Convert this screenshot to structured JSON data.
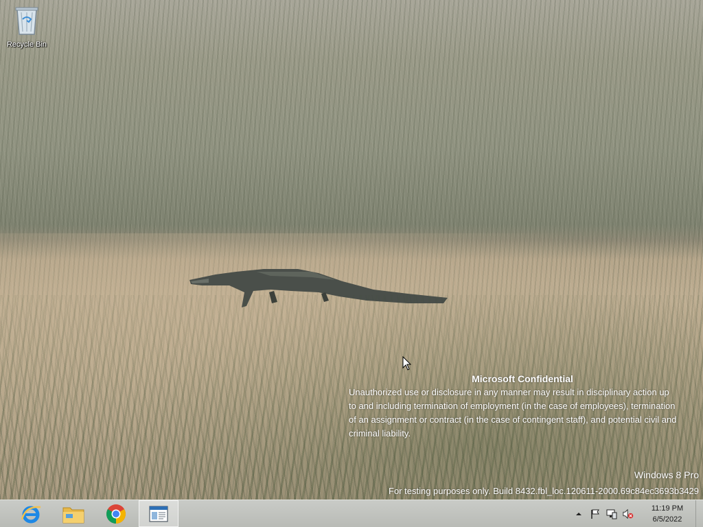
{
  "desktop": {
    "wallpaper": "alligator-in-marsh-grass",
    "icons": [
      {
        "label": "Recycle Bin",
        "icon": "recycle-bin-icon"
      }
    ]
  },
  "watermark": {
    "title": "Microsoft Confidential",
    "body": "Unauthorized use or disclosure in any manner may result in disciplinary action up to and including termination of employment (in the case of employees), termination of an assignment or contract (in the case of contingent staff), and potential civil and criminal liability.",
    "edition": "Windows 8 Pro",
    "build": "For testing purposes only. Build 8432.fbl_loc.120611-2000.69c84ec3693b3429"
  },
  "taskbar": {
    "pinned": [
      {
        "name": "internet-explorer",
        "icon": "internet-explorer-icon",
        "active": false
      },
      {
        "name": "file-explorer",
        "icon": "folder-icon",
        "active": false
      },
      {
        "name": "google-chrome",
        "icon": "chrome-icon",
        "active": false
      },
      {
        "name": "open-window",
        "icon": "window-icon",
        "active": true
      }
    ],
    "tray": {
      "icons": [
        "show-hidden-icons-arrow",
        "action-center-flag-icon",
        "network-icon",
        "volume-muted-icon"
      ],
      "time": "11:19 PM",
      "date": "6/5/2022"
    }
  },
  "colors": {
    "taskbar": "#c0c2bd",
    "watermark_text": "#ffffff",
    "chrome_red": "#db4437",
    "chrome_green": "#0f9d58",
    "chrome_yellow": "#f4b400",
    "chrome_blue": "#4285f4",
    "ie_blue": "#1e88e5"
  }
}
